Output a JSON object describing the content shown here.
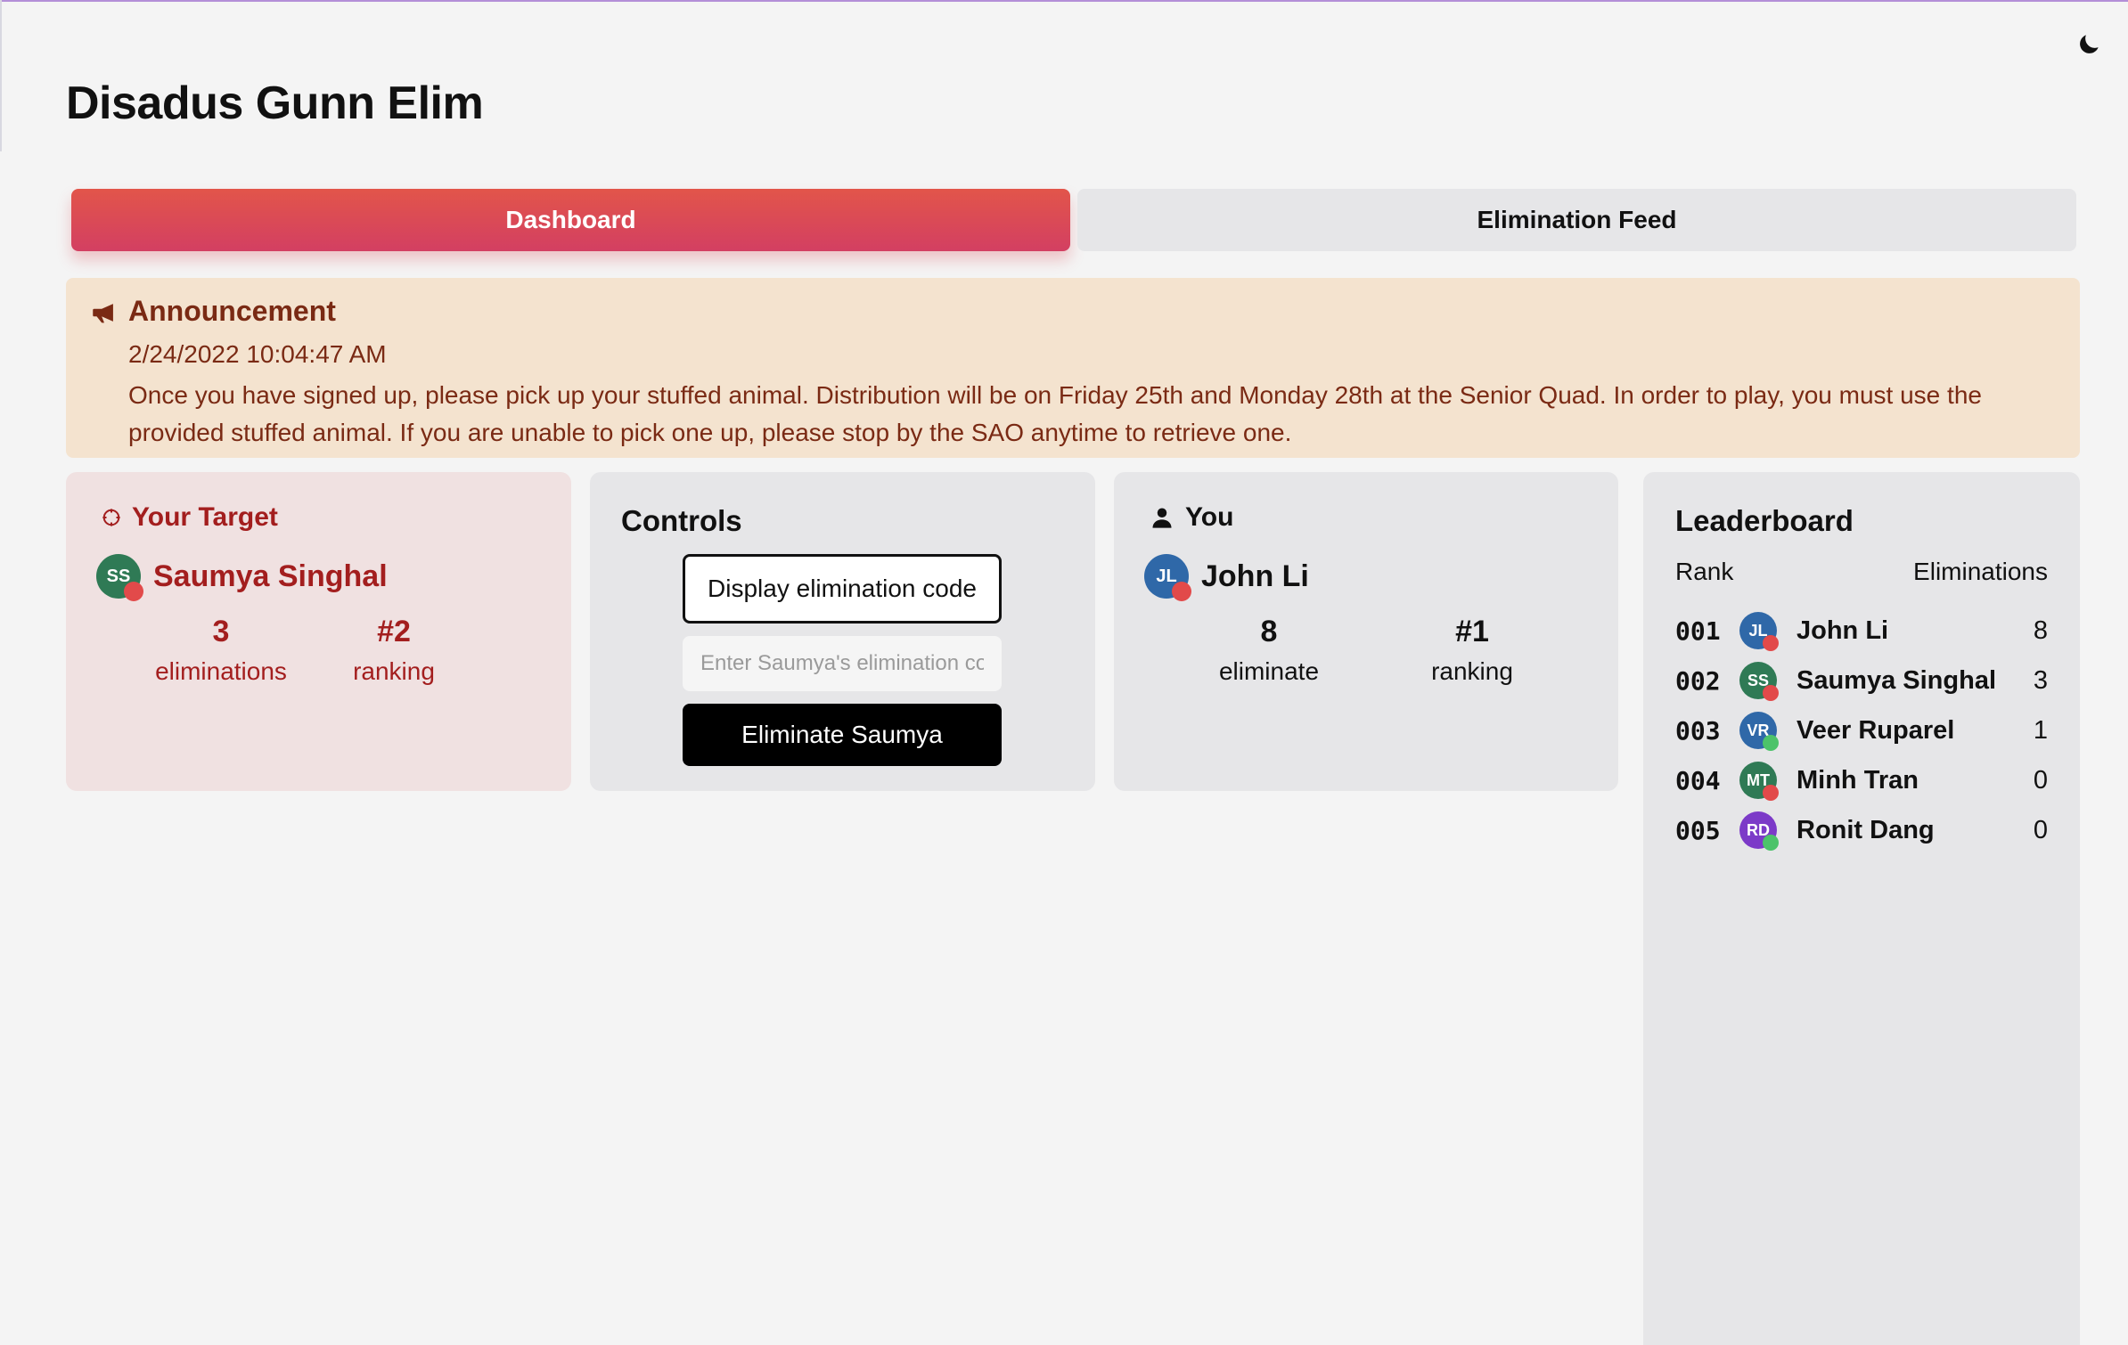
{
  "app": {
    "title": "Disadus Gunn Elim"
  },
  "colors": {
    "accent_start": "#e2554a",
    "accent_end": "#d33f62",
    "target_text": "#a31e1e",
    "announcement_bg": "#f4e3cf",
    "status_red": "#e24a4a",
    "status_green": "#4cc36a"
  },
  "tabs": [
    {
      "label": "Dashboard",
      "active": true
    },
    {
      "label": "Elimination Feed",
      "active": false
    }
  ],
  "announcement": {
    "icon": "megaphone-icon",
    "title": "Announcement",
    "date": "2/24/2022 10:04:47 AM",
    "body": "Once you have signed up, please pick up your stuffed animal. Distribution will be on Friday 25th and Monday 28th at the Senior Quad. In order to play, you must use the provided stuffed animal. If you are unable to pick one up, please stop by the SAO anytime to retrieve one."
  },
  "target": {
    "icon": "crosshair-icon",
    "heading": "Your Target",
    "initials": "SS",
    "name": "Saumya Singhal",
    "avatar_color": "#2f7a55",
    "status_color": "#e24a4a",
    "eliminations_value": "3",
    "eliminations_label": "eliminations",
    "ranking_value": "#2",
    "ranking_label": "ranking"
  },
  "controls": {
    "heading": "Controls",
    "display_code_label": "Display elimination code",
    "code_placeholder": "Enter Saumya's elimination code",
    "eliminate_label": "Eliminate Saumya"
  },
  "you": {
    "icon": "user-icon",
    "heading": "You",
    "initials": "JL",
    "name": "John Li",
    "avatar_color": "#2f68a8",
    "status_color": "#e24a4a",
    "eliminate_value": "8",
    "eliminate_label": "eliminate",
    "ranking_value": "#1",
    "ranking_label": "ranking"
  },
  "leaderboard": {
    "heading": "Leaderboard",
    "col_rank": "Rank",
    "col_elims": "Eliminations",
    "rows": [
      {
        "rank": "001",
        "initials": "JL",
        "name": "John Li",
        "count": "8",
        "avatar_color": "#2f68a8",
        "status_color": "#e24a4a"
      },
      {
        "rank": "002",
        "initials": "SS",
        "name": "Saumya Singhal",
        "count": "3",
        "avatar_color": "#2f7a55",
        "status_color": "#e24a4a"
      },
      {
        "rank": "003",
        "initials": "VR",
        "name": "Veer Ruparel",
        "count": "1",
        "avatar_color": "#2f68a8",
        "status_color": "#4cc36a"
      },
      {
        "rank": "004",
        "initials": "MT",
        "name": "Minh Tran",
        "count": "0",
        "avatar_color": "#2f7a55",
        "status_color": "#e24a4a"
      },
      {
        "rank": "005",
        "initials": "RD",
        "name": "Ronit Dang",
        "count": "0",
        "avatar_color": "#7c3ac8",
        "status_color": "#4cc36a"
      }
    ]
  },
  "theme_toggle_icon": "moon-icon"
}
